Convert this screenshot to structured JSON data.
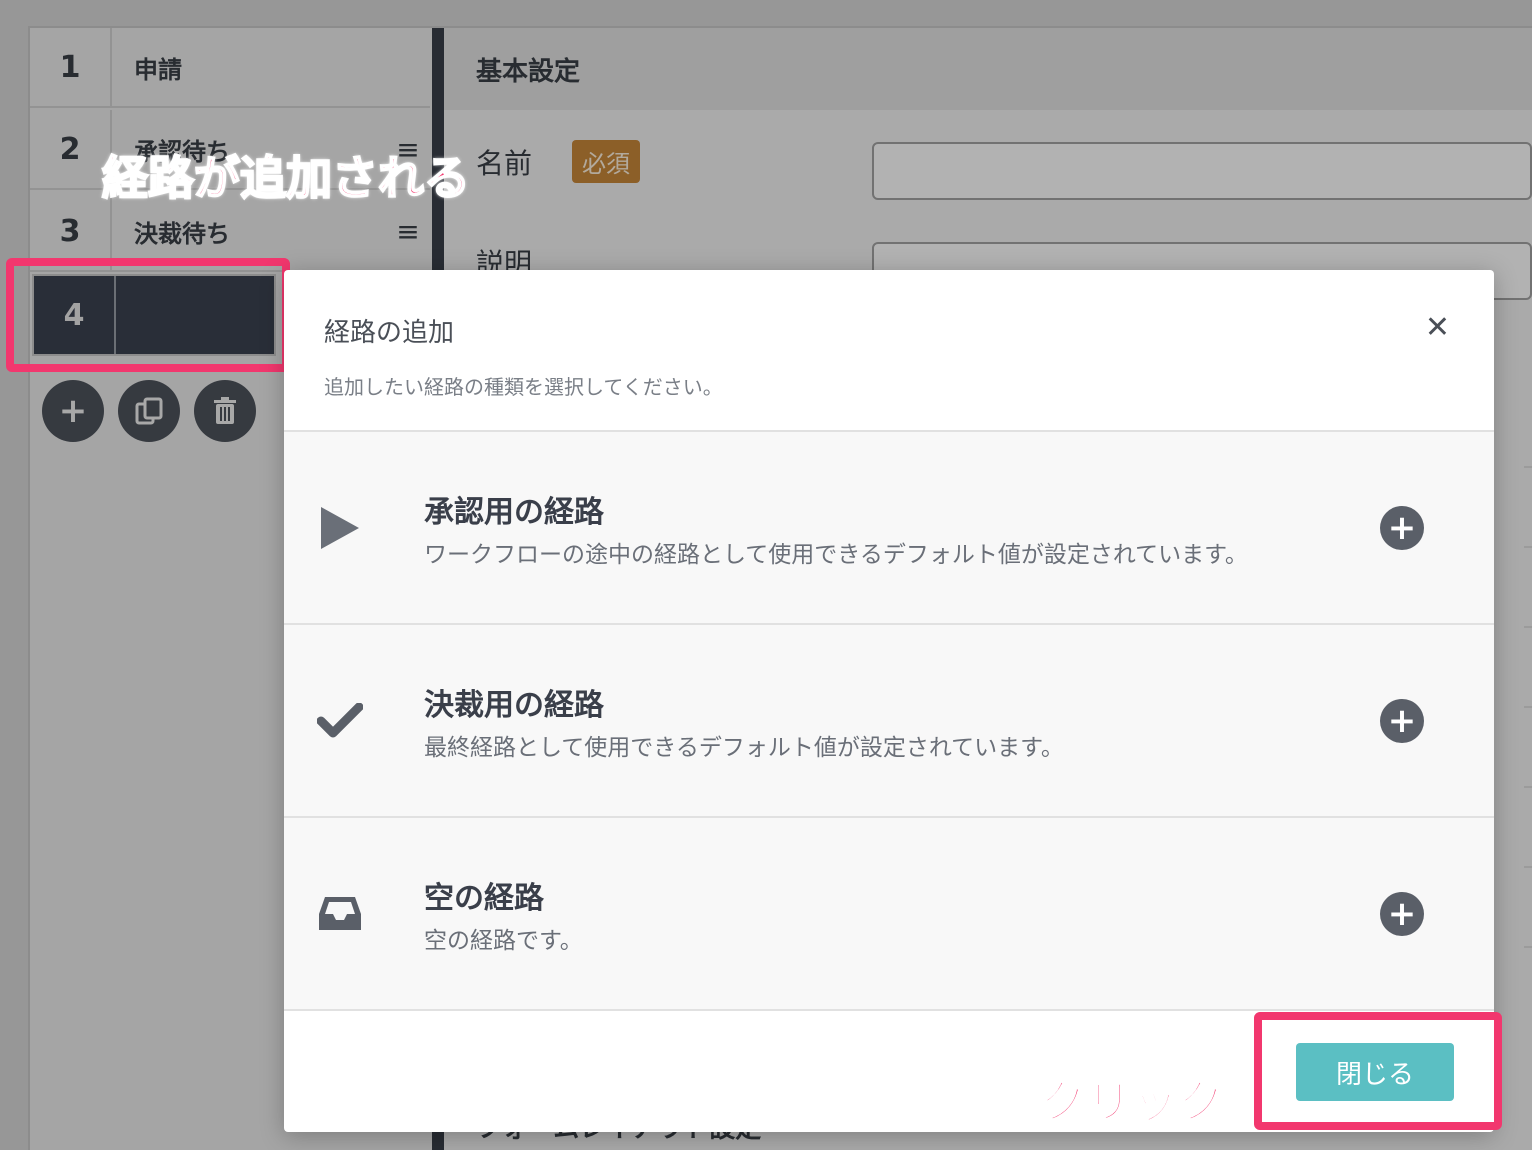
{
  "steps": [
    {
      "number": "1",
      "label": "申請"
    },
    {
      "number": "2",
      "label": "承認待ち"
    },
    {
      "number": "3",
      "label": "決裁待ち"
    },
    {
      "number": "4",
      "label": ""
    }
  ],
  "step_menu_icon": "≡",
  "step_tools": [
    {
      "icon": "plus-icon"
    },
    {
      "icon": "copy-icon"
    },
    {
      "icon": "trash-icon"
    }
  ],
  "settings": {
    "heading": "基本設定",
    "name_label": "名前",
    "required_badge": "必須",
    "description_label": "説明",
    "footer_heading": "フォームレイアウト設定"
  },
  "modal": {
    "title": "経路の追加",
    "subtitle": "追加したい経路の種類を選択してください。",
    "options": [
      {
        "icon": "play-icon",
        "title": "承認用の経路",
        "description": "ワークフローの途中の経路として使用できるデフォルト値が設定されています。"
      },
      {
        "icon": "check-icon",
        "title": "決裁用の経路",
        "description": "最終経路として使用できるデフォルト値が設定されています。"
      },
      {
        "icon": "inbox-icon",
        "title": "空の経路",
        "description": "空の経路です。"
      }
    ],
    "close_label": "閉じる"
  },
  "annotations": {
    "route_added": "経路が追加される",
    "click": "クリック"
  },
  "colors": {
    "accent_highlight": "#f2376e",
    "close_button": "#5bbfc3",
    "required_badge": "#c9893a",
    "active_step": "#3b4251"
  }
}
